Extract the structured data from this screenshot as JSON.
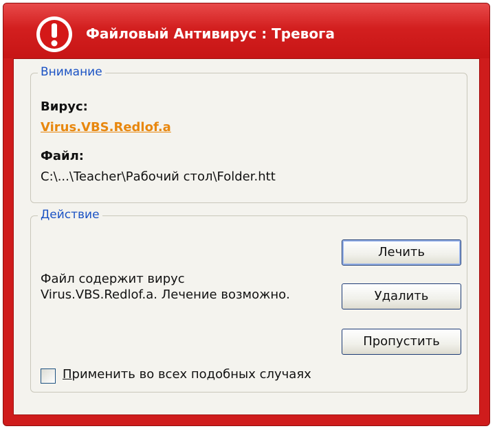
{
  "window": {
    "title": "Файловый Антивирус : Тревога",
    "icon": "alert-exclamation-icon"
  },
  "warning_group": {
    "legend": "Внимание",
    "virus_label": "Вирус:",
    "virus_name": "Virus.VBS.Redlof.a",
    "file_label": "Файл:",
    "file_path": "C:\\...\\Teacher\\Рабочий стол\\Folder.htt"
  },
  "action_group": {
    "legend": "Действие",
    "description": "Файл содержит вирус Virus.VBS.Redlof.a. Лечение возможно.",
    "buttons": {
      "cure": "Лечить",
      "delete": "Удалить",
      "skip": "Пропустить"
    },
    "apply_all": {
      "mnemonic": "П",
      "rest": "рименить во всех подобных случаях",
      "checked": false
    }
  },
  "colors": {
    "frame": "#cf1c1c",
    "link": "#e8870e",
    "legend": "#1a52c4",
    "client_bg": "#f4f3ee"
  }
}
